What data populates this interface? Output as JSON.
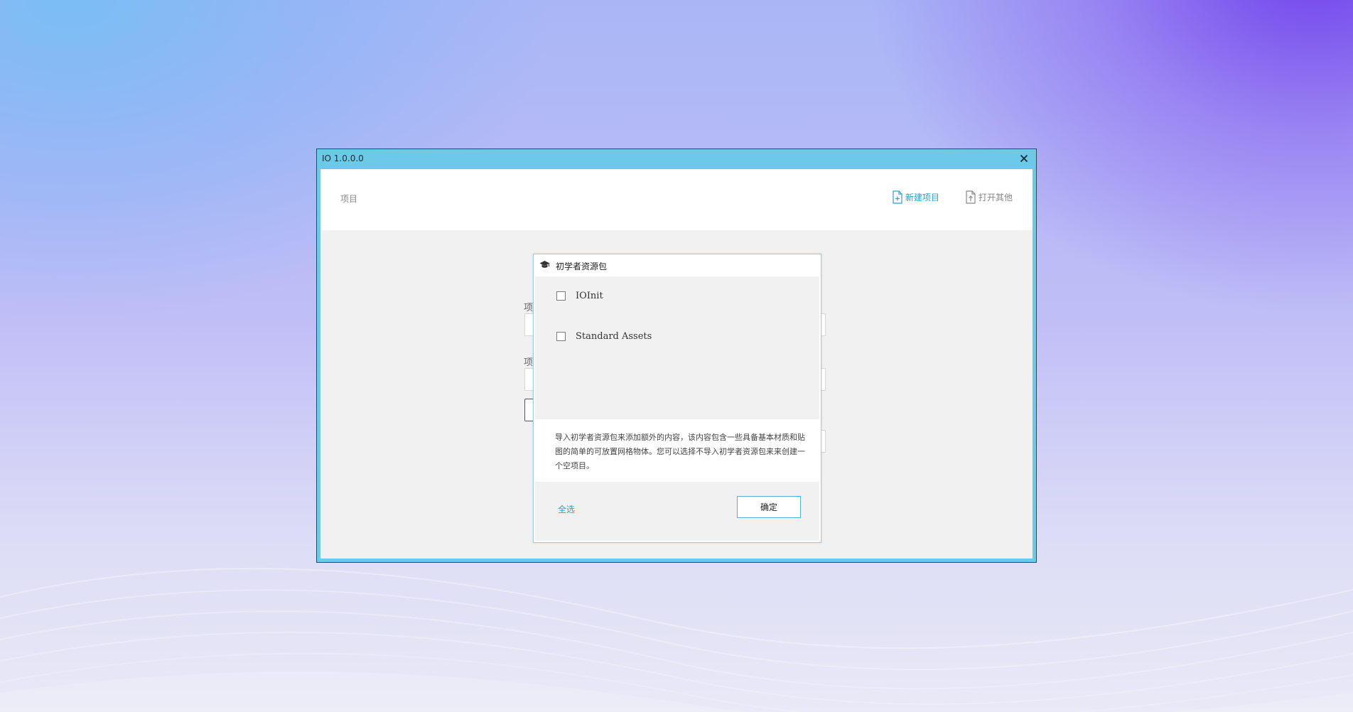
{
  "window": {
    "title": "IO 1.0.0.0",
    "close_icon": "close-icon"
  },
  "header": {
    "title": "项目",
    "new_project_label": "新建项目",
    "new_project_icon": "new-file-icon",
    "open_other_label": "打开其他",
    "open_other_icon": "open-file-icon"
  },
  "background_form": {
    "label_1": "项",
    "label_2": "项"
  },
  "dialog": {
    "title": "初学者资源包",
    "icon": "graduation-cap-icon",
    "packages": [
      {
        "label": "IOInit",
        "checked": false
      },
      {
        "label": "Standard Assets",
        "checked": false
      }
    ],
    "description": "导入初学者资源包来添加额外的内容，该内容包含一些具备基本材质和贴图的简单的可放置网格物体。您可以选择不导入初学者资源包来来创建一个空项目。",
    "select_all_label": "全选",
    "confirm_label": "确定"
  },
  "colors": {
    "titlebar": "#6ccae9",
    "accent": "#2aa2cc",
    "panel": "#f1f1f1"
  }
}
